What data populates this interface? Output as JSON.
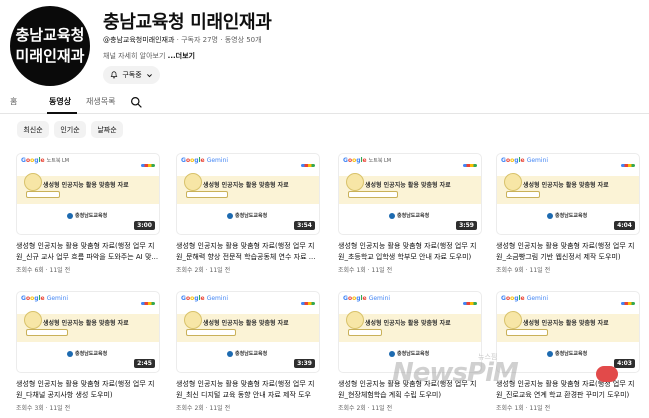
{
  "channel": {
    "avatar_line1": "충남교육청",
    "avatar_line2": "미래인재과",
    "title": "충남교육청 미래인재과",
    "handle": "@충남교육청미래인재과",
    "subscribers": "구독자 27명",
    "video_count": "동영상 50개",
    "description": "채널 자세히 알아보기",
    "more": "...더보기",
    "subscribe_label": "구독중"
  },
  "tabs": [
    {
      "label": "홈"
    },
    {
      "label": "동영상",
      "active": true
    },
    {
      "label": "재생목록"
    }
  ],
  "chips": [
    {
      "label": "최신순"
    },
    {
      "label": "인기순"
    },
    {
      "label": "날짜순"
    }
  ],
  "thumb": {
    "headline": "생성형 인공지능 활용 맞춤형 자료",
    "org": "충청남도교육청"
  },
  "videos": [
    {
      "brand": "Google",
      "brand_sub": "노트북 LM",
      "duration": "3:00",
      "title": "생성형 인공지능 활용 맞춤형 자료(행정 업무 지원_신규 교사 업무 흐름 파악을 도와주는 AI 맞...",
      "stats": "조회수 6회 · 11일 전"
    },
    {
      "brand": "Google Gemini",
      "brand_sub": "",
      "duration": "3:54",
      "title": "생성형 인공지능 활용 맞춤형 자료(행정 업무 지원_문해력 향상 전문적 학습공동체 연수 자료 ...",
      "stats": "조회수 2회 · 11일 전"
    },
    {
      "brand": "Google",
      "brand_sub": "노트북 LM",
      "duration": "3:59",
      "title": "생성형 인공지능 활용 맞춤형 자료(행정 업무 지원_초등학교 입학생 학부모 안내 자료 도우미)",
      "stats": "조회수 1회 · 11일 전"
    },
    {
      "brand": "Google Gemini",
      "brand_sub": "",
      "duration": "4:04",
      "title": "생성형 인공지능 활용 맞춤형 자료(행정 업무 지원_소금빵그림 기반 웹신정서 제작 도우미)",
      "stats": "조회수 9회 · 11일 전"
    },
    {
      "brand": "Google Gemini",
      "brand_sub": "",
      "duration": "2:45",
      "title": "생성형 인공지능 활용 맞춤형 자료(행정 업무 지원_다채널 공지사항 생성 도우미)",
      "stats": "조회수 3회 · 11일 전"
    },
    {
      "brand": "Google Gemini",
      "brand_sub": "",
      "duration": "3:39",
      "title": "생성형 인공지능 활용 맞춤형 자료(행정 업무 지원_최신 디지털 교육 동향 안내 자료 제작 도우미)",
      "stats": "조회수 2회 · 11일 전"
    },
    {
      "brand": "Google Gemini",
      "brand_sub": "",
      "duration": "",
      "title": "생성형 인공지능 활용 맞춤형 자료(행정 업무 지원_현장체험학습 계획 수립 도우미)",
      "stats": "조회수 2회 · 11일 전"
    },
    {
      "brand": "Google Gemini",
      "brand_sub": "",
      "duration": "4:03",
      "title": "생성형 인공지능 활용 맞춤형 자료(행정 업무 지원_진로교육 연계 학교 환경판 꾸미기 도우미)",
      "stats": "조회수 1회 · 11일 전"
    }
  ],
  "watermark": {
    "text": "NewsPiM",
    "small": "뉴스핌"
  }
}
